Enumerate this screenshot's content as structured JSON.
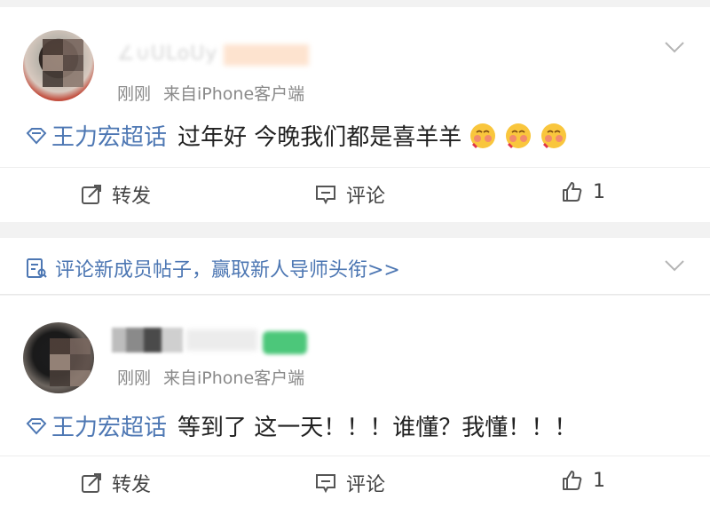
{
  "posts": [
    {
      "username": "∠∪ULoUy",
      "time": "刚刚",
      "source": "来自iPhone客户端",
      "topic": "王力宏超话",
      "text": "过年好 今晚我们都是喜羊羊",
      "emoji_icons": [
        "blushing-face-icon",
        "blushing-face-icon",
        "blushing-face-icon"
      ],
      "actions": {
        "repost": "转发",
        "comment": "评论",
        "like_count": "1"
      }
    },
    {
      "time": "刚刚",
      "source": "来自iPhone客户端",
      "topic": "王力宏超话",
      "text": "等到了 这一天！！！谁懂？我懂！！！",
      "actions": {
        "repost": "转发",
        "comment": "评论",
        "like_count": "1"
      }
    }
  ],
  "banner": {
    "text": "评论新成员帖子，赢取新人导师头衔>>"
  },
  "colors": {
    "link_blue": "#4d77b3",
    "meta_gray": "#8a8a8a",
    "page_background": "#f2f2f2"
  }
}
